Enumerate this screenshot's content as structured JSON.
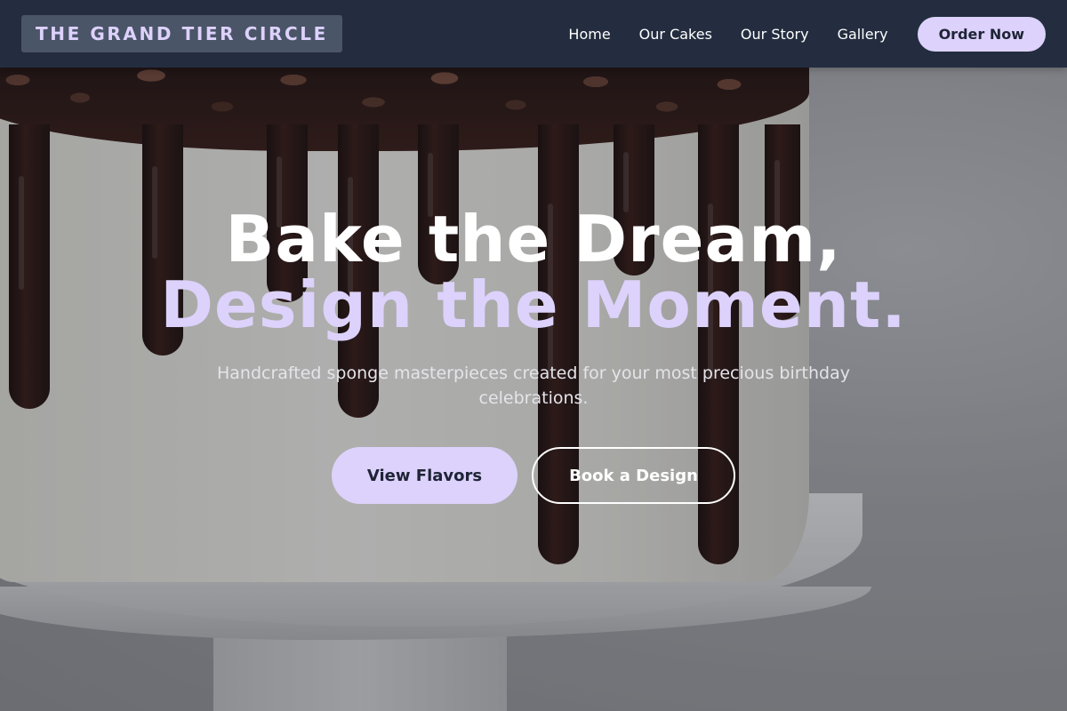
{
  "header": {
    "brand": "THE GRAND TIER CIRCLE",
    "nav": [
      {
        "label": "Home"
      },
      {
        "label": "Our Cakes"
      },
      {
        "label": "Our Story"
      },
      {
        "label": "Gallery"
      }
    ],
    "cta_label": "Order Now"
  },
  "hero": {
    "title_line1": "Bake the Dream,",
    "title_line2": "Design the Moment.",
    "subtitle": "Handcrafted sponge masterpieces created for your most precious birthday celebrations.",
    "primary_cta": "View Flavors",
    "secondary_cta": "Book a Design"
  },
  "colors": {
    "header_bg": "#232d3f",
    "accent_lavender": "#ddd2fb",
    "brand_box": "#4a5568",
    "text_dark": "#1e2436"
  }
}
